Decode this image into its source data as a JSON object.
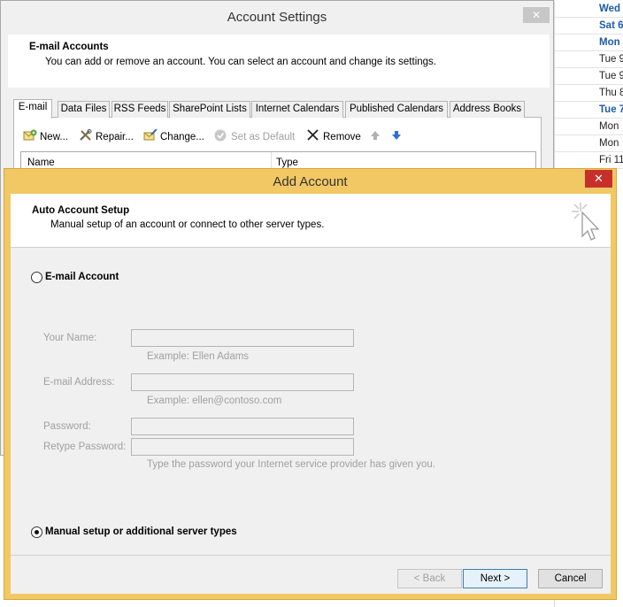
{
  "calendar": {
    "rows": [
      {
        "text": "Wed",
        "highlight": true
      },
      {
        "text": "Sat 6/",
        "highlight": true
      },
      {
        "text": "Mon",
        "highlight": true
      },
      {
        "text": "Tue 9",
        "highlight": false
      },
      {
        "text": "Tue 9",
        "highlight": false
      },
      {
        "text": "Thu 8",
        "highlight": false
      },
      {
        "text": "Tue 7",
        "highlight": true
      },
      {
        "text": "Mon",
        "highlight": false
      },
      {
        "text": "Mon",
        "highlight": false
      },
      {
        "text": "Fri 11",
        "highlight": false
      }
    ]
  },
  "account_settings": {
    "title": "Account Settings",
    "close_glyph": "✕",
    "header_title": "E-mail Accounts",
    "header_desc": "You can add or remove an account. You can select an account and change its settings.",
    "tabs": [
      {
        "label": "E-mail",
        "active": true
      },
      {
        "label": "Data Files",
        "active": false
      },
      {
        "label": "RSS Feeds",
        "active": false
      },
      {
        "label": "SharePoint Lists",
        "active": false
      },
      {
        "label": "Internet Calendars",
        "active": false
      },
      {
        "label": "Published Calendars",
        "active": false
      },
      {
        "label": "Address Books",
        "active": false
      }
    ],
    "toolbar": {
      "new_label": "New...",
      "repair_label": "Repair...",
      "change_label": "Change...",
      "set_default_label": "Set as Default",
      "remove_label": "Remove"
    },
    "columns": {
      "name": "Name",
      "type": "Type"
    }
  },
  "add_account": {
    "title": "Add Account",
    "close_glyph": "✕",
    "header_title": "Auto Account Setup",
    "header_desc": "Manual setup of an account or connect to other server types.",
    "email_option_label": "E-mail Account",
    "email_option_checked": false,
    "fields": {
      "name_label": "Your Name:",
      "name_hint": "Example: Ellen Adams",
      "email_label": "E-mail Address:",
      "email_hint": "Example: ellen@contoso.com",
      "password_label": "Password:",
      "retype_label": "Retype Password:",
      "password_hint": "Type the password your Internet service provider has given you."
    },
    "manual_option_label": "Manual setup or additional server types",
    "manual_option_checked": true,
    "buttons": {
      "back_label": "< Back",
      "next_label": "Next >",
      "cancel_label": "Cancel"
    }
  },
  "colors": {
    "dialog_frame": "#f2c865",
    "close_red": "#c7302a",
    "calendar_blue": "#1e5ba8",
    "disabled_text": "#a0a0a0"
  }
}
